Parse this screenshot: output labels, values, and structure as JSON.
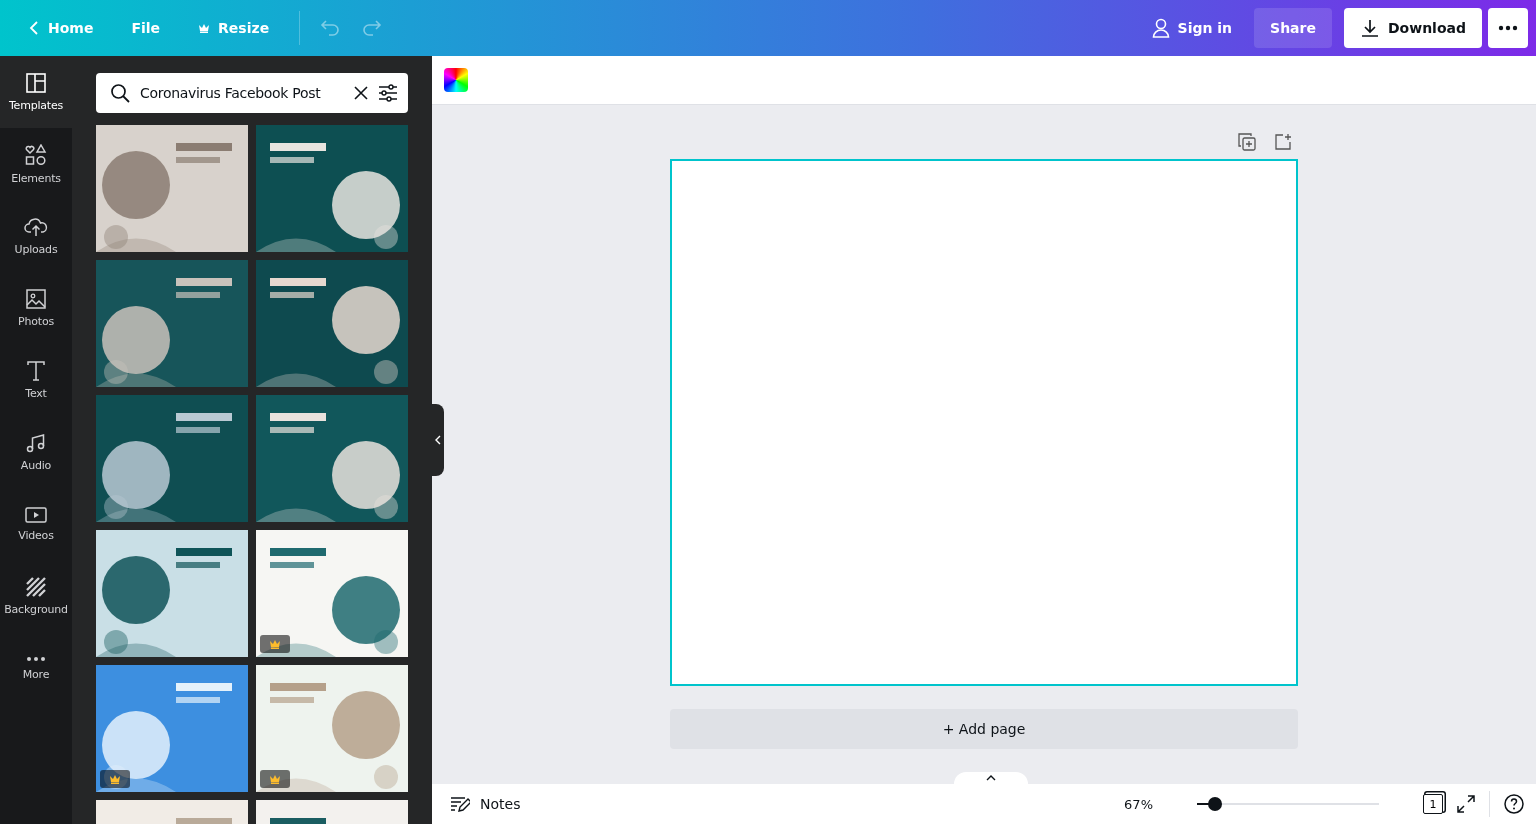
{
  "topbar": {
    "back": "Home",
    "menu": [
      "File",
      "Resize"
    ],
    "sign_in": "Sign in",
    "share": "Share",
    "download": "Download"
  },
  "sidebar": {
    "items": [
      {
        "label": "Templates",
        "selected": true
      },
      {
        "label": "Elements",
        "selected": false
      },
      {
        "label": "Uploads",
        "selected": false
      },
      {
        "label": "Photos",
        "selected": false
      },
      {
        "label": "Text",
        "selected": false
      },
      {
        "label": "Audio",
        "selected": false
      },
      {
        "label": "Videos",
        "selected": false
      },
      {
        "label": "Background",
        "selected": false
      },
      {
        "label": "More",
        "selected": false
      }
    ]
  },
  "panel": {
    "search": {
      "value": "Coronavirus Facebook Post"
    },
    "templates": [
      {
        "kind": "picture",
        "premium": false
      },
      {
        "kind": "picture",
        "premium": false
      },
      {
        "kind": "picture",
        "premium": false
      },
      {
        "kind": "picture",
        "premium": false
      },
      {
        "kind": "picture",
        "premium": false
      },
      {
        "kind": "picture",
        "premium": false
      },
      {
        "kind": "picture",
        "premium": false
      },
      {
        "kind": "picture",
        "premium": true
      },
      {
        "kind": "picture",
        "premium": true
      },
      {
        "kind": "picture",
        "premium": true
      },
      {
        "kind": "picture"
      },
      {
        "kind": "picture"
      }
    ]
  },
  "editor": {
    "add_page": "+ Add page"
  },
  "footer": {
    "notes": "Notes",
    "zoom": "67%",
    "level": 0.1,
    "page_count": "1"
  }
}
